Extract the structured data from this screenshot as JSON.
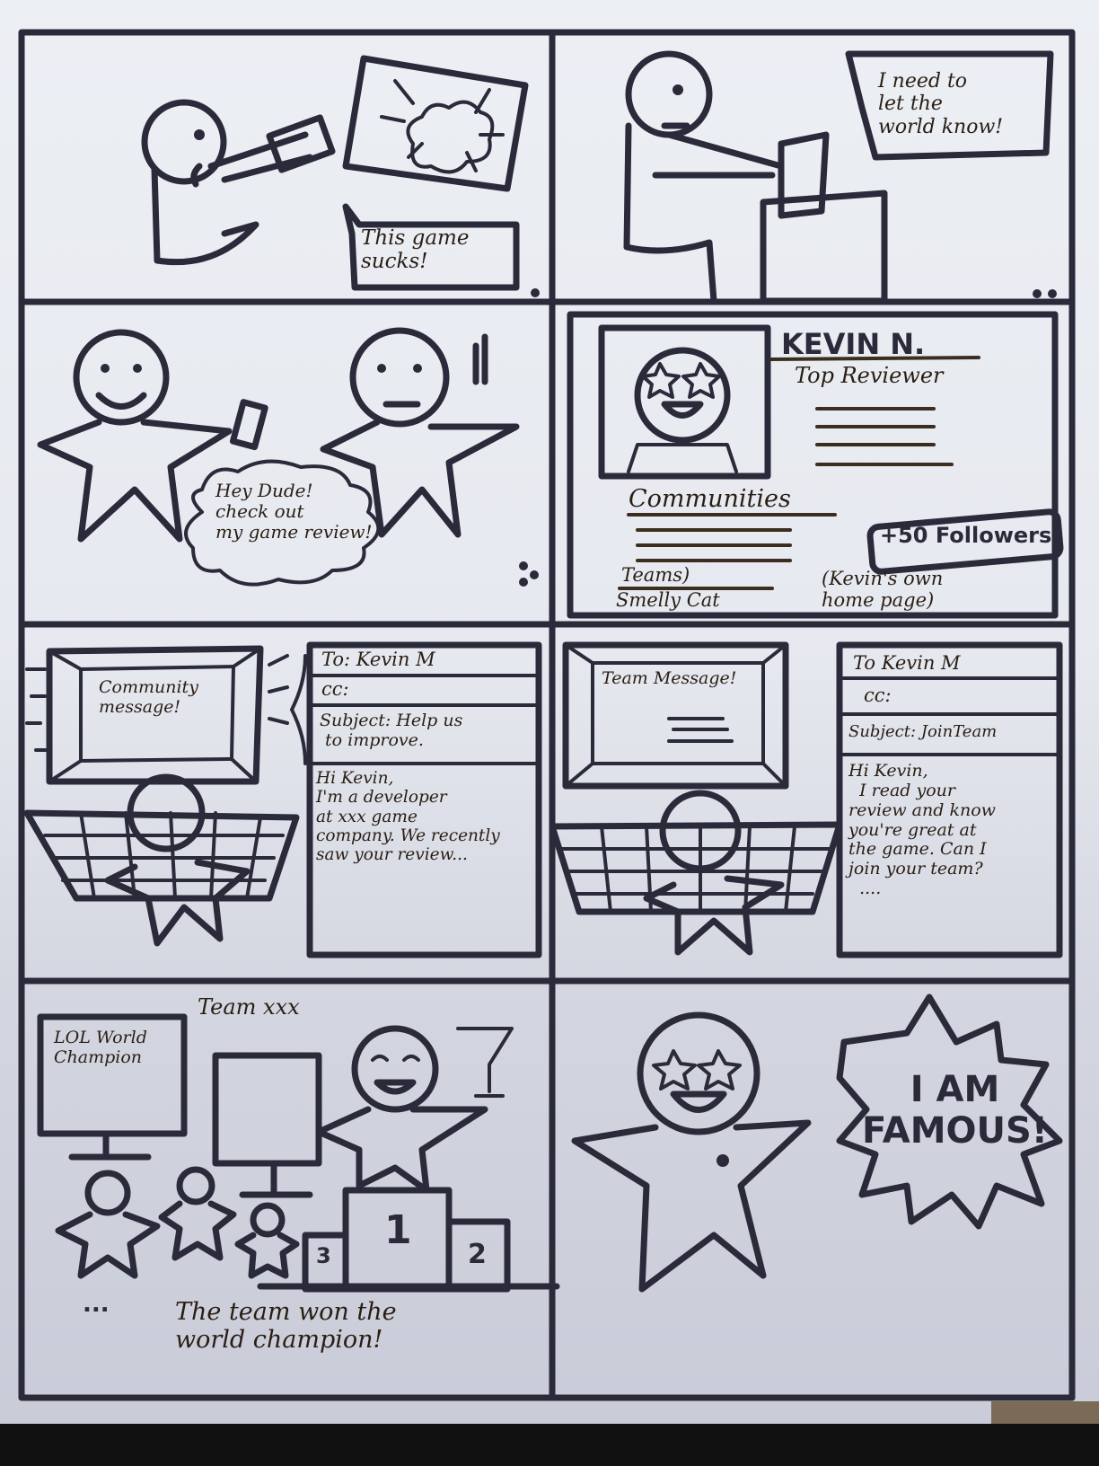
{
  "panels": {
    "p1": {
      "speech": "This game\nsucks!"
    },
    "p2": {
      "speech": "I need to\nlet the\nworld know!"
    },
    "p3": {
      "speech": "Hey Dude!\ncheck out\nmy game review!"
    },
    "p4": {
      "name": "KEVIN N.",
      "role": "Top Reviewer",
      "communities": "Communities",
      "teams_label": "Teams)",
      "team_name": "Smelly Cat",
      "badge": "+50 Followers",
      "note": "(Kevin's own\nhome page)"
    },
    "p5": {
      "screen": "Community\nmessage!",
      "to": "To: Kevin M",
      "cc": "cc:",
      "subject": "Subject: Help us\n to improve.",
      "body": "Hi Kevin,\nI'm a developer\nat xxx game\ncompany. We recently\nsaw your review..."
    },
    "p6": {
      "screen": "Team Message!",
      "to": "To Kevin M",
      "cc": "cc:",
      "subject": "Subject: JoinTeam",
      "body": "Hi Kevin,\n  I read your\nreview and know\nyou're great at\nthe game. Can I\njoin your team?\n  ...."
    },
    "p7": {
      "team": "Team xxx",
      "monitor": "LOL World\nChampion",
      "podium": [
        "1",
        "2",
        "3"
      ],
      "dots": "...",
      "caption": "The team won the\nworld champion!"
    },
    "p8": {
      "shout": "I AM\nFAMOUS!"
    }
  }
}
